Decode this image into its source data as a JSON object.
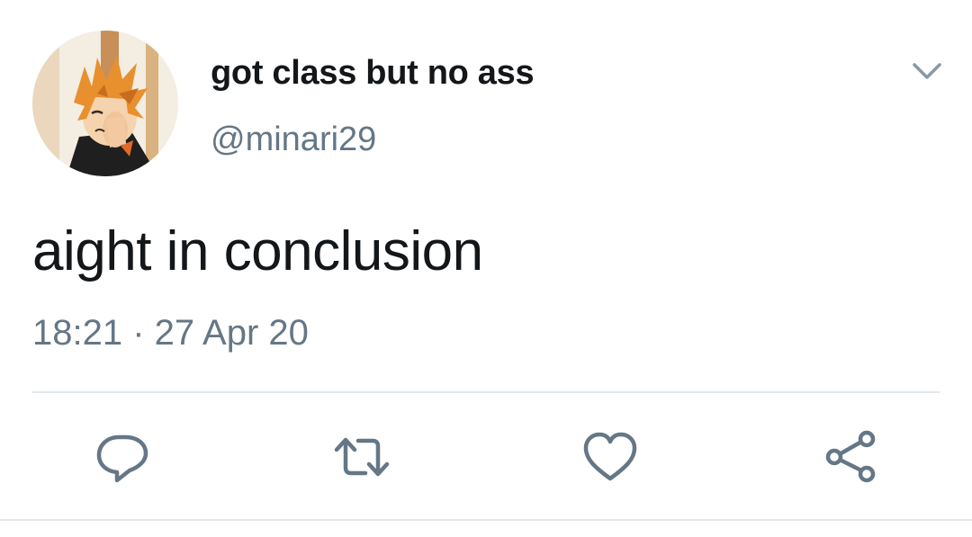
{
  "tweet": {
    "display_name": "got class but no ass",
    "handle": "@minari29",
    "text": "aight in conclusion",
    "timestamp": "18:21 · 27 Apr 20"
  },
  "icons": {
    "menu": "chevron-down-icon",
    "reply": "comment-bubble-icon",
    "retweet": "retweet-arrows-icon",
    "like": "heart-icon",
    "share": "share-nodes-icon"
  },
  "colors": {
    "text": "#14171a",
    "secondary": "#657786",
    "divider": "#e1e8ed",
    "icon": "#657786"
  }
}
